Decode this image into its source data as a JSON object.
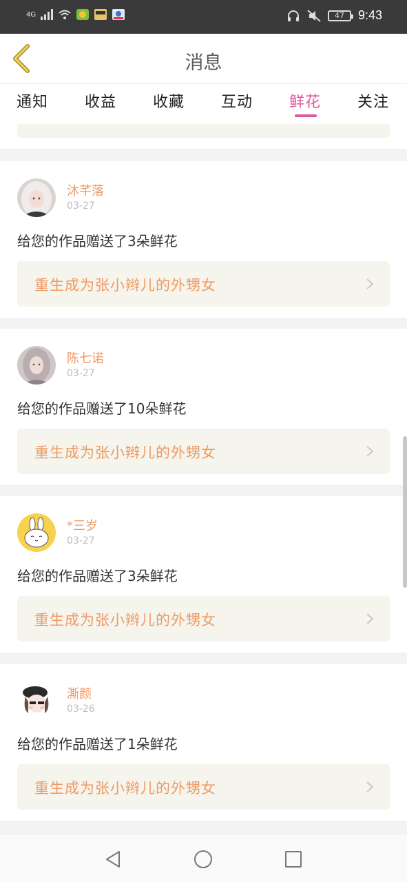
{
  "status_bar": {
    "network": "4G",
    "battery": "47",
    "time": "9:43"
  },
  "header": {
    "title": "消息"
  },
  "tabs": [
    {
      "label": "通知"
    },
    {
      "label": "收益"
    },
    {
      "label": "收藏"
    },
    {
      "label": "互动"
    },
    {
      "label": "鲜花",
      "active": true
    },
    {
      "label": "关注"
    }
  ],
  "messages": [
    {
      "user": "沐芊落",
      "date": "03-27",
      "text": "给您的作品赠送了3朵鲜花",
      "work": "重生成为张小辫儿的外甥女",
      "avatar": "girl-white-hair-avatar"
    },
    {
      "user": "陈七诺",
      "date": "03-27",
      "text": "给您的作品赠送了10朵鲜花",
      "work": "重生成为张小辫儿的外甥女",
      "avatar": "girl-grey-hair-avatar"
    },
    {
      "user": "*三岁",
      "date": "03-27",
      "text": "给您的作品赠送了3朵鲜花",
      "work": "重生成为张小辫儿的外甥女",
      "avatar": "cartoon-bunny-avatar"
    },
    {
      "user": "澌颜",
      "date": "03-26",
      "text": "给您的作品赠送了1朵鲜花",
      "work": "重生成为张小辫儿的外甥女",
      "avatar": "cartoon-girl-beret-avatar"
    }
  ],
  "colors": {
    "accent": "#e0569c",
    "username": "#ef9a63",
    "work_bg": "#f5f5ee"
  }
}
